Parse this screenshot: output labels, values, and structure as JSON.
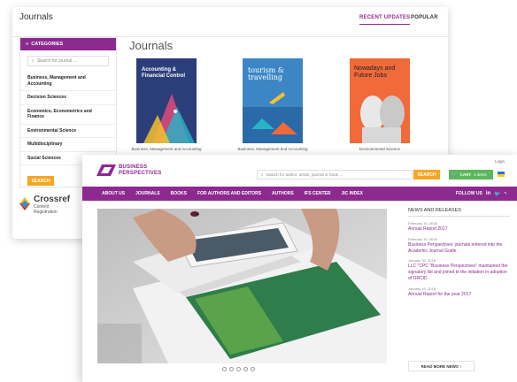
{
  "back_window": {
    "title": "Journals",
    "tabs": [
      {
        "label": "RECENT UPDATES",
        "active": true
      },
      {
        "label": "POPULAR",
        "active": false
      }
    ],
    "sidebar": {
      "header": "CATEGORIES",
      "search_placeholder": "Search for journal ...",
      "items": [
        "Business, Management and Accounting",
        "Decision Sciences",
        "Economics, Econometrics and Finance",
        "Environmental Science",
        "Multidisciplinary",
        "Social Sciences"
      ],
      "button": "SEARCH"
    },
    "crossref": {
      "name": "Crossref",
      "sub1": "Content",
      "sub2": "Registration"
    },
    "heading": "Journals",
    "covers": [
      {
        "title": "Accounting & Financial Control",
        "caption": "Business, Management and Accounting",
        "color": "#2c3e7a"
      },
      {
        "title": "tourism & travelling",
        "caption": "Business, Management and Accounting",
        "color": "#3d86c6"
      },
      {
        "title": "Nowadays and Future Jobs",
        "caption": "Environmental Science",
        "color": "#f06a3a"
      }
    ]
  },
  "front_window": {
    "logo_line1": "BUSINESS",
    "logo_line2": "PERSPECTIVES",
    "search_placeholder": "Search for author, article, journal or book ...",
    "search_button": "SEARCH",
    "cart_label": "CART",
    "cart_count": "1 items",
    "login": "Login",
    "nav": [
      "ABOUT US",
      "JOURNALS",
      "BOOKS",
      "FOR AUTHORS AND EDITORS",
      "AUTHORS",
      "IFS CENTER",
      "JIC INDEX"
    ],
    "follow_label": "FOLLOW US",
    "news": {
      "heading": "NEWS AND RELEASES",
      "items": [
        {
          "date": "February 16, 2018",
          "title": "Annual Report 2017"
        },
        {
          "date": "February 15, 2018",
          "title": "Business Perspectives' journals entered into the Academic Journal Guide"
        },
        {
          "date": "January 30, 2018",
          "title": "LLC \"CPC \"Business Perspectives\" maintained the signatory list and joined to the initiation in adoption of ORCID"
        },
        {
          "date": "January 10, 2018",
          "title": "Annual Report for the year 2017"
        }
      ],
      "more_button": "READ MORE NEWS"
    }
  },
  "colors": {
    "brand": "#8c2a8f",
    "accent": "#f5a623",
    "cart": "#5cb85c"
  }
}
